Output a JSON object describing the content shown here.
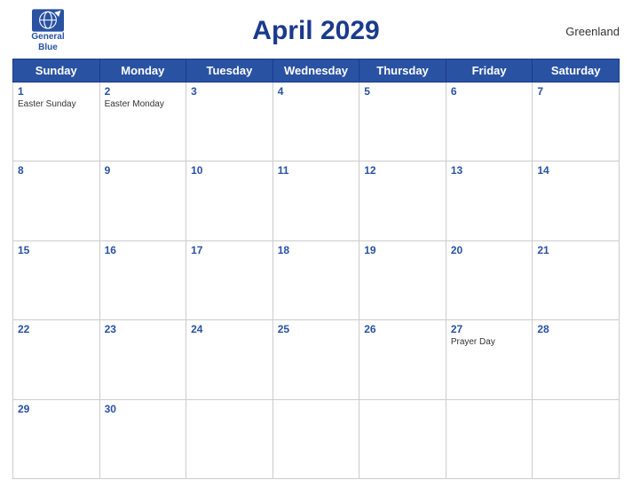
{
  "header": {
    "logo": {
      "line1": "General",
      "line2": "Blue"
    },
    "title": "April 2029",
    "region": "Greenland"
  },
  "weekdays": [
    "Sunday",
    "Monday",
    "Tuesday",
    "Wednesday",
    "Thursday",
    "Friday",
    "Saturday"
  ],
  "weeks": [
    [
      {
        "day": "1",
        "events": [
          "Easter Sunday"
        ]
      },
      {
        "day": "2",
        "events": [
          "Easter Monday"
        ]
      },
      {
        "day": "3",
        "events": []
      },
      {
        "day": "4",
        "events": []
      },
      {
        "day": "5",
        "events": []
      },
      {
        "day": "6",
        "events": []
      },
      {
        "day": "7",
        "events": []
      }
    ],
    [
      {
        "day": "8",
        "events": []
      },
      {
        "day": "9",
        "events": []
      },
      {
        "day": "10",
        "events": []
      },
      {
        "day": "11",
        "events": []
      },
      {
        "day": "12",
        "events": []
      },
      {
        "day": "13",
        "events": []
      },
      {
        "day": "14",
        "events": []
      }
    ],
    [
      {
        "day": "15",
        "events": []
      },
      {
        "day": "16",
        "events": []
      },
      {
        "day": "17",
        "events": []
      },
      {
        "day": "18",
        "events": []
      },
      {
        "day": "19",
        "events": []
      },
      {
        "day": "20",
        "events": []
      },
      {
        "day": "21",
        "events": []
      }
    ],
    [
      {
        "day": "22",
        "events": []
      },
      {
        "day": "23",
        "events": []
      },
      {
        "day": "24",
        "events": []
      },
      {
        "day": "25",
        "events": []
      },
      {
        "day": "26",
        "events": []
      },
      {
        "day": "27",
        "events": [
          "Prayer Day"
        ]
      },
      {
        "day": "28",
        "events": []
      }
    ],
    [
      {
        "day": "29",
        "events": []
      },
      {
        "day": "30",
        "events": []
      },
      {
        "day": "",
        "events": []
      },
      {
        "day": "",
        "events": []
      },
      {
        "day": "",
        "events": []
      },
      {
        "day": "",
        "events": []
      },
      {
        "day": "",
        "events": []
      }
    ]
  ]
}
